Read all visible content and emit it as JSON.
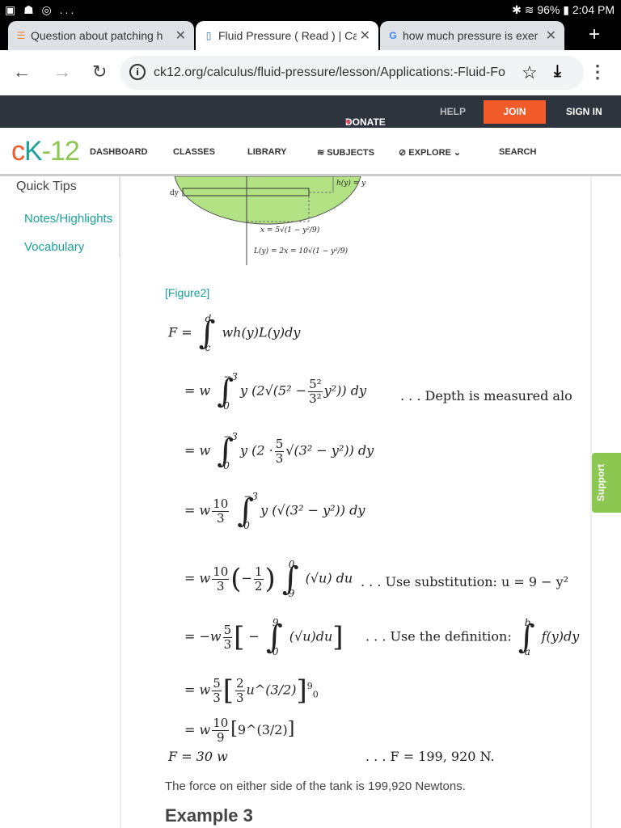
{
  "status": {
    "left_icons": "▣ ☗ ◎ ...",
    "battery": "96%",
    "time": "2:04 PM",
    "bt": "✱ ≋"
  },
  "tabs": [
    {
      "title": "Question about patching h",
      "icon": "stack-icon"
    },
    {
      "title": "Fluid Pressure ( Read ) | Ca",
      "icon": "doc-icon"
    },
    {
      "title": "how much pressure is exer",
      "icon": "google-icon"
    }
  ],
  "tab_close": "✕",
  "new_tab": "+",
  "address": {
    "url": "ck12.org/calculus/fluid-pressure/lesson/Applications:-Fluid-Fo"
  },
  "topbar": {
    "donate": "DONATE",
    "help": "HELP",
    "join": "JOIN",
    "signin": "SIGN IN"
  },
  "nav": {
    "logo_c": "c",
    "logo_k": "K",
    "logo_12": "-12",
    "dashboard": "DASHBOARD",
    "classes": "CLASSES",
    "library": "LIBRARY",
    "subjects": "SUBJECTS",
    "explore": "EXPLORE",
    "search": "SEARCH"
  },
  "sidebar": {
    "title": "Quick Tips",
    "links": [
      "Notes/Highlights",
      "Vocabulary"
    ]
  },
  "figure": {
    "dy": "dy",
    "h": "h(y) = y",
    "x_eq": "x = 5√(1 − y²/9)",
    "L_eq": "L(y) = 2x = 10√(1 − y²/9)",
    "caption": "[Figure2]"
  },
  "math": {
    "l1": {
      "lhs": "F =",
      "up": "d",
      "lo": "c",
      "body": "wh(y)L(y)dy"
    },
    "l2": {
      "pre": "= w",
      "up": "−3",
      "lo": "0",
      "a": "y (2√(5² −",
      "n": "5²",
      "d": "3²",
      "b": "y²)) dy",
      "note": ". . . Depth is measured alo"
    },
    "l3": {
      "pre": "= w",
      "up": "−3",
      "lo": "0",
      "a": "y (2 ·",
      "n": "5",
      "d": "3",
      "b": "√(3² − y²)) dy"
    },
    "l4": {
      "pre": "= w",
      "n": "10",
      "d": "3",
      "up": "−3",
      "lo": "0",
      "b": "y (√(3² − y²)) dy"
    },
    "l5": {
      "pre": "= w",
      "n": "10",
      "d": "3",
      "n2": "1",
      "d2": "2",
      "up": "0",
      "lo": "9",
      "b": "(√u) du",
      "note": ". . . Use substitution: u = 9 − y²"
    },
    "l6": {
      "pre": "= −w",
      "n": "5",
      "d": "3",
      "up": "9",
      "lo": "0",
      "b": "(√u)du",
      "note": ". . . Use the definition:",
      "nup": "b",
      "nlo": "a",
      "nb": "f(y)dy"
    },
    "l7": {
      "pre": "= w",
      "n": "5",
      "d": "3",
      "n2": "2",
      "d2": "3",
      "b": "u^(3/2)",
      "up": "9",
      "lo": "0"
    },
    "l8": {
      "pre": "= w",
      "n": "10",
      "d": "9",
      "b": "9^(3/2)"
    },
    "l9": {
      "lhs": "F = 30 w",
      "note": ". . . F = 199, 920 N."
    }
  },
  "result_text": "The force on either side of the tank is 199,920 Newtons.",
  "example_heading": "Example 3",
  "support": "Support",
  "colors": {
    "accent": "#1aa29b",
    "join": "#f15a29",
    "topbar": "#2e343e",
    "support": "#8cc751",
    "ellipse": "#b2e283"
  }
}
